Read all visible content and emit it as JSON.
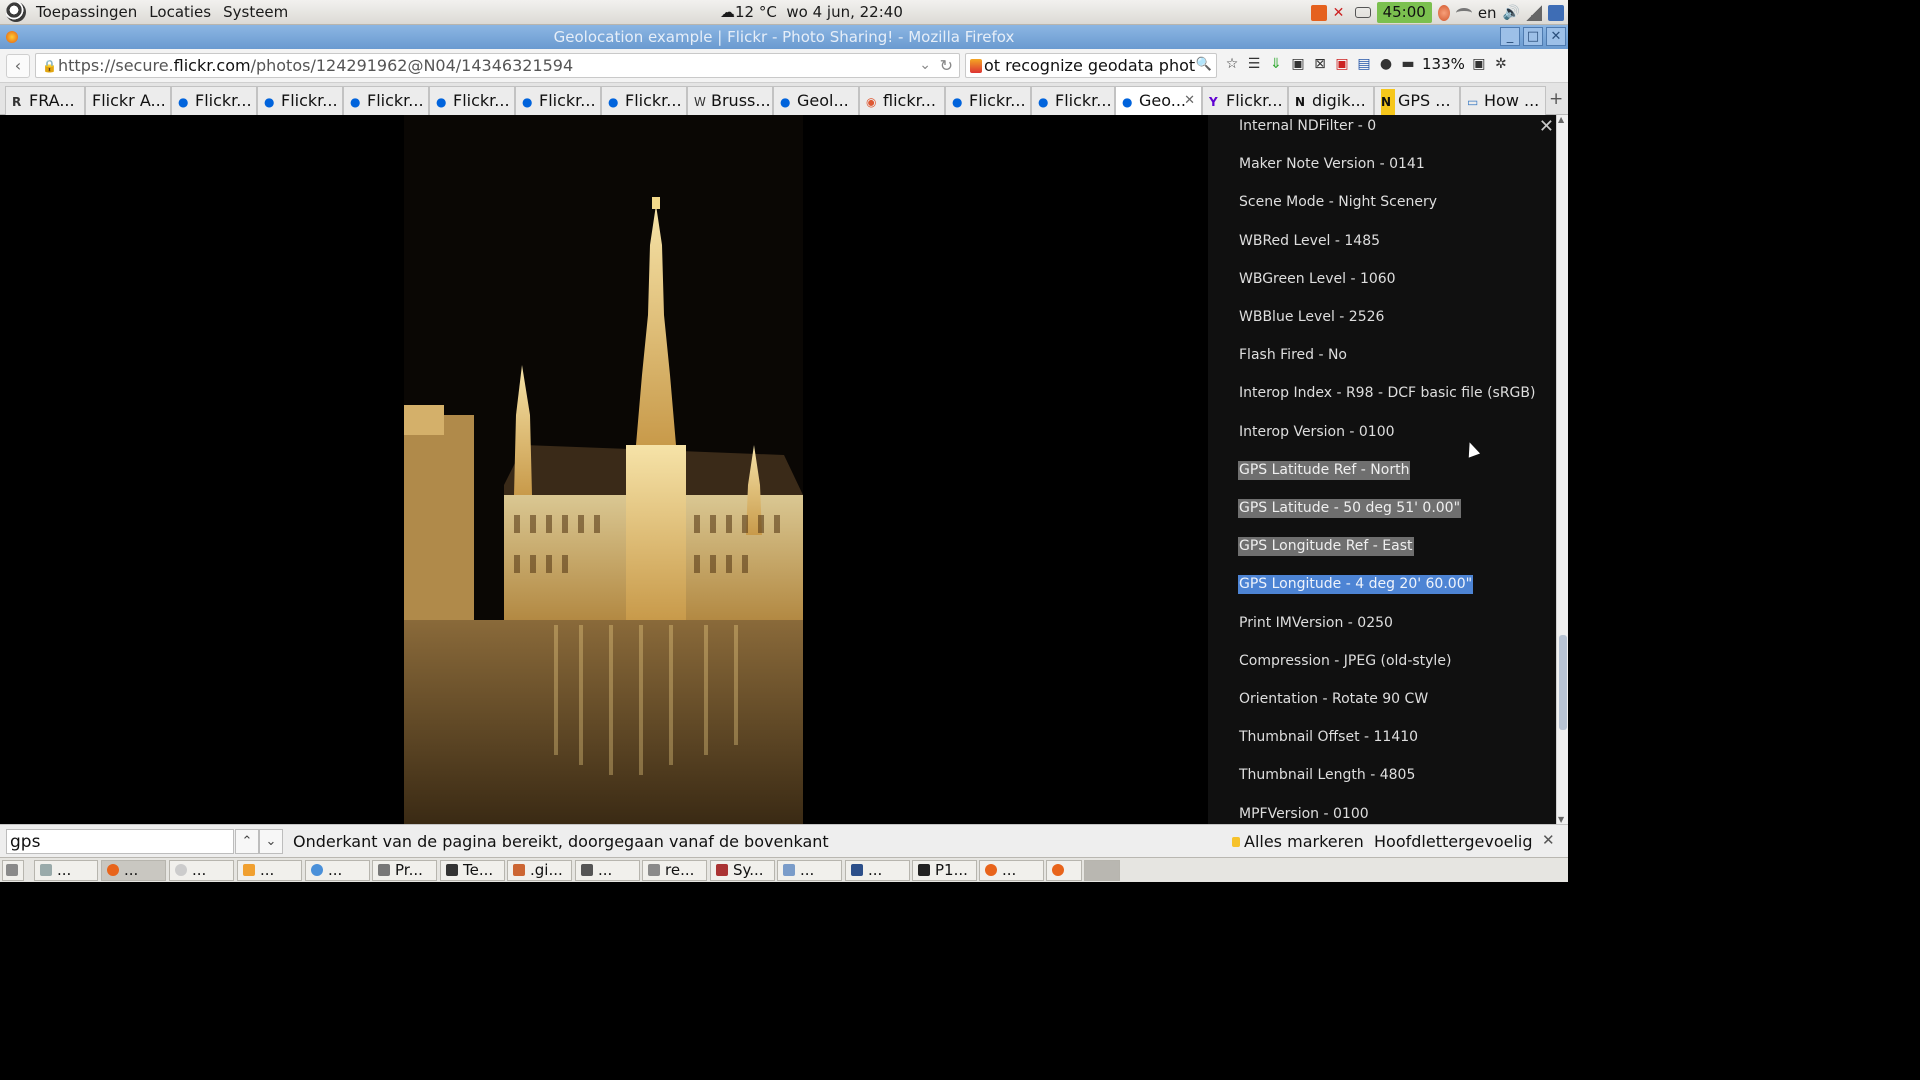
{
  "panel": {
    "menus": [
      "Toepassingen",
      "Locaties",
      "Systeem"
    ],
    "weather": "12 °C",
    "datetime": "wo  4 jun, 22:40",
    "timer": "45:00",
    "keyboard_layout": "en"
  },
  "window": {
    "title": "Geolocation example | Flickr - Photo Sharing! - Mozilla Firefox"
  },
  "navbar": {
    "url_prefix": "https://secure.",
    "url_domain": "flickr.com",
    "url_path": "/photos/124291962@N04/14346321594",
    "search_value": "ot recognize geodata photo",
    "zoom": "133%"
  },
  "tabs": [
    {
      "label": "FRA...",
      "icon": "r-favicon"
    },
    {
      "label": "Flickr A...",
      "icon": "none"
    },
    {
      "label": "Flickr...",
      "icon": "flickr-favicon"
    },
    {
      "label": "Flickr...",
      "icon": "flickr-favicon"
    },
    {
      "label": "Flickr...",
      "icon": "flickr-favicon"
    },
    {
      "label": "Flickr...",
      "icon": "flickr-favicon"
    },
    {
      "label": "Flickr...",
      "icon": "flickr-favicon"
    },
    {
      "label": "Flickr...",
      "icon": "flickr-favicon"
    },
    {
      "label": "Bruss...",
      "icon": "wikipedia-favicon"
    },
    {
      "label": "Geol...",
      "icon": "flickr-favicon"
    },
    {
      "label": "flickr...",
      "icon": "duckduckgo-favicon"
    },
    {
      "label": "Flickr...",
      "icon": "flickr-favicon"
    },
    {
      "label": "Flickr...",
      "icon": "flickr-favicon"
    },
    {
      "label": "Geo...",
      "icon": "flickr-favicon",
      "active": true
    },
    {
      "label": "Flickr...",
      "icon": "yahoo-favicon"
    },
    {
      "label": "digik...",
      "icon": "n-favicon"
    },
    {
      "label": "GPS ...",
      "icon": "n-yellow-favicon"
    },
    {
      "label": "How ...",
      "icon": "stackexchange-favicon"
    }
  ],
  "exif": {
    "items": [
      {
        "text": "Internal NDFilter - 0",
        "state": ""
      },
      {
        "text": "Maker Note Version - 0141",
        "state": ""
      },
      {
        "text": "Scene Mode - Night Scenery",
        "state": ""
      },
      {
        "text": "WBRed Level - 1485",
        "state": ""
      },
      {
        "text": "WBGreen Level - 1060",
        "state": ""
      },
      {
        "text": "WBBlue Level - 2526",
        "state": ""
      },
      {
        "text": "Flash Fired - No",
        "state": ""
      },
      {
        "text": "Interop Index - R98 - DCF basic file (sRGB)",
        "state": ""
      },
      {
        "text": "Interop Version - 0100",
        "state": ""
      },
      {
        "text": "GPS Latitude Ref - North",
        "state": "sel"
      },
      {
        "text": "GPS Latitude - 50 deg 51' 0.00\"",
        "state": "sel"
      },
      {
        "text": "GPS Longitude Ref - East",
        "state": "sel"
      },
      {
        "text": "GPS Longitude - 4 deg 20' 60.00\"",
        "state": "sel2"
      },
      {
        "text": "Print IMVersion - 0250",
        "state": ""
      },
      {
        "text": "Compression - JPEG (old-style)",
        "state": ""
      },
      {
        "text": "Orientation - Rotate 90 CW",
        "state": ""
      },
      {
        "text": "Thumbnail Offset - 11410",
        "state": ""
      },
      {
        "text": "Thumbnail Length - 4805",
        "state": ""
      },
      {
        "text": "MPFVersion - 0100",
        "state": ""
      }
    ]
  },
  "findbar": {
    "query": "gps",
    "status": "Onderkant van de pagina bereikt, doorgegaan vanaf de bovenkant",
    "highlight_all": "Alles markeren",
    "match_case": "Hoofdlettergevoelig"
  },
  "taskbar": {
    "items": [
      {
        "label": "...",
        "icon": "image-viewer-icon"
      },
      {
        "label": "...",
        "icon": "firefox-icon",
        "active": true
      },
      {
        "label": "...",
        "icon": "clock-icon"
      },
      {
        "label": "...",
        "icon": "bird-icon"
      },
      {
        "label": "...",
        "icon": "chromium-icon"
      },
      {
        "label": "Pr...",
        "icon": "document-icon"
      },
      {
        "label": "Te...",
        "icon": "terminal-icon"
      },
      {
        "label": ".gi...",
        "icon": "editor-icon"
      },
      {
        "label": "...",
        "icon": "calculator-icon"
      },
      {
        "label": "re...",
        "icon": "folder-icon"
      },
      {
        "label": "Sy...",
        "icon": "system-monitor-icon"
      },
      {
        "label": "...",
        "icon": "window-icon"
      },
      {
        "label": "...",
        "icon": "inkscape-icon"
      },
      {
        "label": "P1...",
        "icon": "phone-icon"
      },
      {
        "label": "...",
        "icon": "firefox-icon"
      },
      {
        "label": "",
        "icon": "firefox-icon"
      }
    ]
  },
  "colors": {
    "selection_grey": "#6f6f6f",
    "selection_blue": "#4d84d4",
    "timer_green": "#7bc04f",
    "titlebar_blue": "#7aa8dc"
  }
}
